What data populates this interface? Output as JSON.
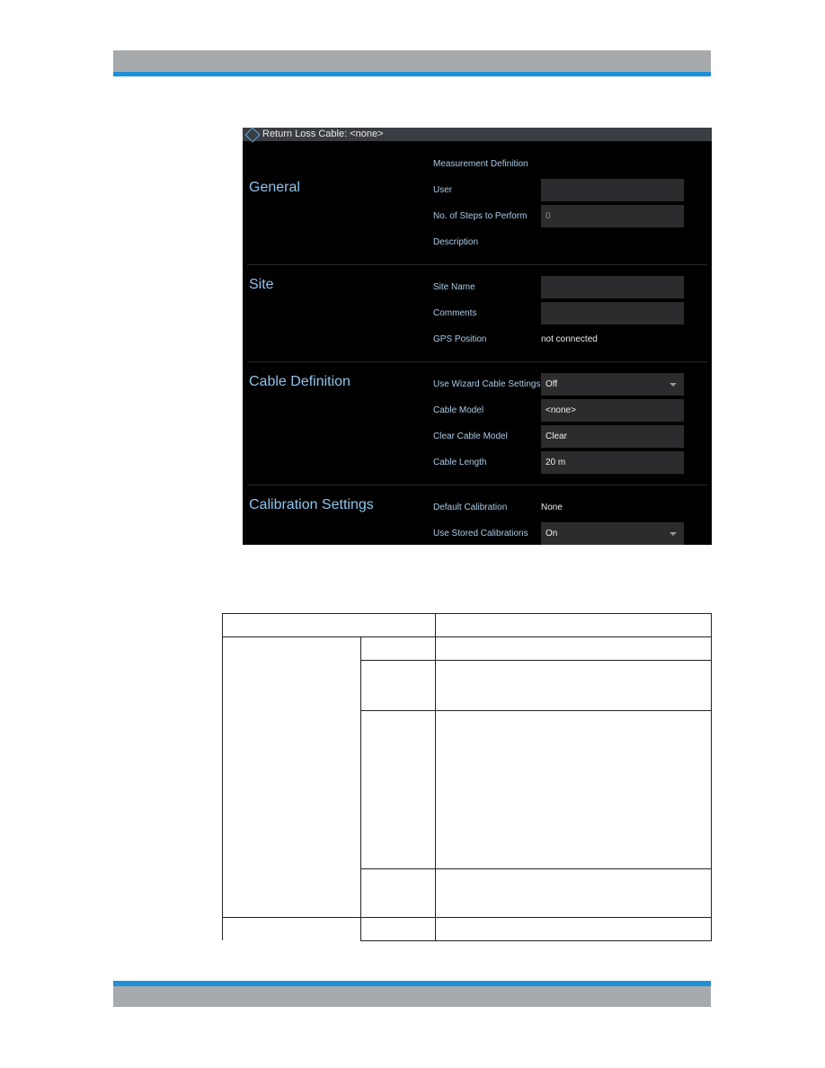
{
  "colors": {
    "band_gray": "#a7aaad",
    "band_blue": "#1e90d6",
    "panel_bg": "#000000",
    "heading": "#8fc4ec"
  },
  "dialog": {
    "title": "Return Loss  Cable: <none>",
    "icon": "rohde-schwarz-diamond-icon",
    "sections": {
      "general": {
        "heading": "General",
        "measurement_definition": "Measurement Definition",
        "user_label": "User",
        "user_value": "",
        "steps_label": "No. of Steps to Perform",
        "steps_value": "0",
        "description_label": "Description"
      },
      "site": {
        "heading": "Site",
        "site_name_label": "Site Name",
        "site_name_value": "",
        "comments_label": "Comments",
        "comments_value": "",
        "gps_label": "GPS Position",
        "gps_value": "not connected"
      },
      "cable": {
        "heading": "Cable Definition",
        "wizard_label": "Use Wizard Cable Settings",
        "wizard_value": "Off",
        "model_label": "Cable Model",
        "model_value": "<none>",
        "clear_label": "Clear Cable Model",
        "clear_button": "Clear",
        "length_label": "Cable Length",
        "length_value": "20 m"
      },
      "calibration": {
        "heading": "Calibration Settings",
        "default_label": "Default Calibration",
        "default_value": "None",
        "stored_label": "Use Stored Calibrations",
        "stored_value": "On"
      }
    }
  }
}
